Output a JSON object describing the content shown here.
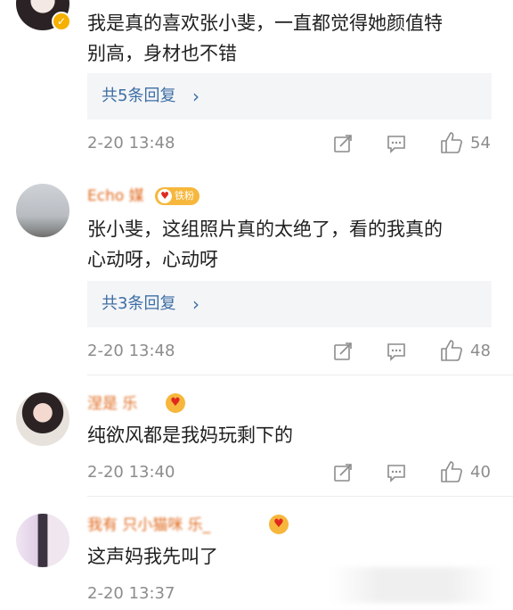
{
  "comments": [
    {
      "username": "",
      "text": "我是真的喜欢张小斐，一直都觉得她颜值特\n别高，身材也不错",
      "replies_label": "共5条回复",
      "timestamp": "2-20 13:48",
      "likes": "54"
    },
    {
      "username": "Echo 媒",
      "badge": "铁粉",
      "text": "张小斐，这组照片真的太绝了，看的我真的\n心动呀，心动呀",
      "replies_label": "共3条回复",
      "timestamp": "2-20 13:48",
      "likes": "48"
    },
    {
      "username": "涅是 乐",
      "text": "纯欲风都是我妈玩剩下的",
      "timestamp": "2-20 13:40",
      "likes": "40"
    },
    {
      "username": "我有 只小猫咪 乐_",
      "text": "这声妈我先叫了",
      "timestamp": "2-20 13:37",
      "likes": ""
    }
  ],
  "icons": {
    "verified": "verified-badge-icon",
    "repost": "repost-icon",
    "comment": "comment-icon",
    "like": "like-icon",
    "chevron": "chevron-right-icon"
  },
  "colors": {
    "link": "#3c6ea5",
    "meta": "#8c8c8c",
    "badge": "#f6b73c",
    "username": "#e06a1d"
  }
}
